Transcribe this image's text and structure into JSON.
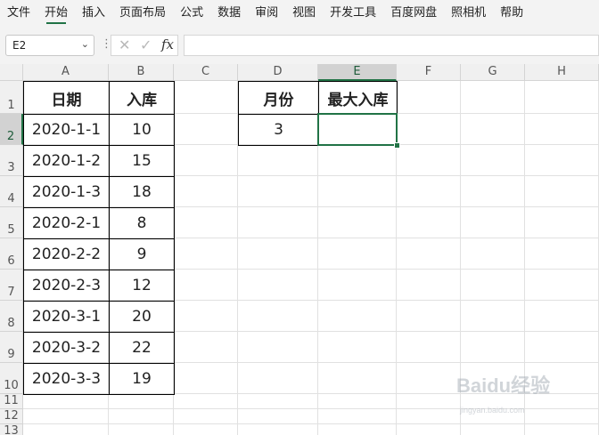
{
  "menu": {
    "items": [
      "文件",
      "开始",
      "插入",
      "页面布局",
      "公式",
      "数据",
      "审阅",
      "视图",
      "开发工具",
      "百度网盘",
      "照相机",
      "帮助"
    ],
    "active": "开始"
  },
  "formula_bar": {
    "name_box": "E2",
    "formula": "",
    "fx_label": "fx"
  },
  "sheet": {
    "columns": [
      "A",
      "B",
      "C",
      "D",
      "E",
      "F",
      "G",
      "H"
    ],
    "rows": [
      "1",
      "2",
      "3",
      "4",
      "5",
      "6",
      "7",
      "8",
      "9",
      "10",
      "11",
      "12",
      "13"
    ],
    "selected_cell": "E2",
    "table1": {
      "headers": [
        "日期",
        "入库"
      ],
      "rows": [
        [
          "2020-1-1",
          "10"
        ],
        [
          "2020-1-2",
          "15"
        ],
        [
          "2020-1-3",
          "18"
        ],
        [
          "2020-2-1",
          "8"
        ],
        [
          "2020-2-2",
          "9"
        ],
        [
          "2020-2-3",
          "12"
        ],
        [
          "2020-3-1",
          "20"
        ],
        [
          "2020-3-2",
          "22"
        ],
        [
          "2020-3-3",
          "19"
        ]
      ]
    },
    "table2": {
      "headers": [
        "月份",
        "最大入库"
      ],
      "values": [
        "3",
        ""
      ]
    }
  },
  "watermark": {
    "brand": "Baidu经验",
    "url": "jingyan.baidu.com"
  },
  "colors": {
    "accent": "#217346",
    "header_bg": "#f0f0f0",
    "gridline": "#e1e1e1"
  }
}
